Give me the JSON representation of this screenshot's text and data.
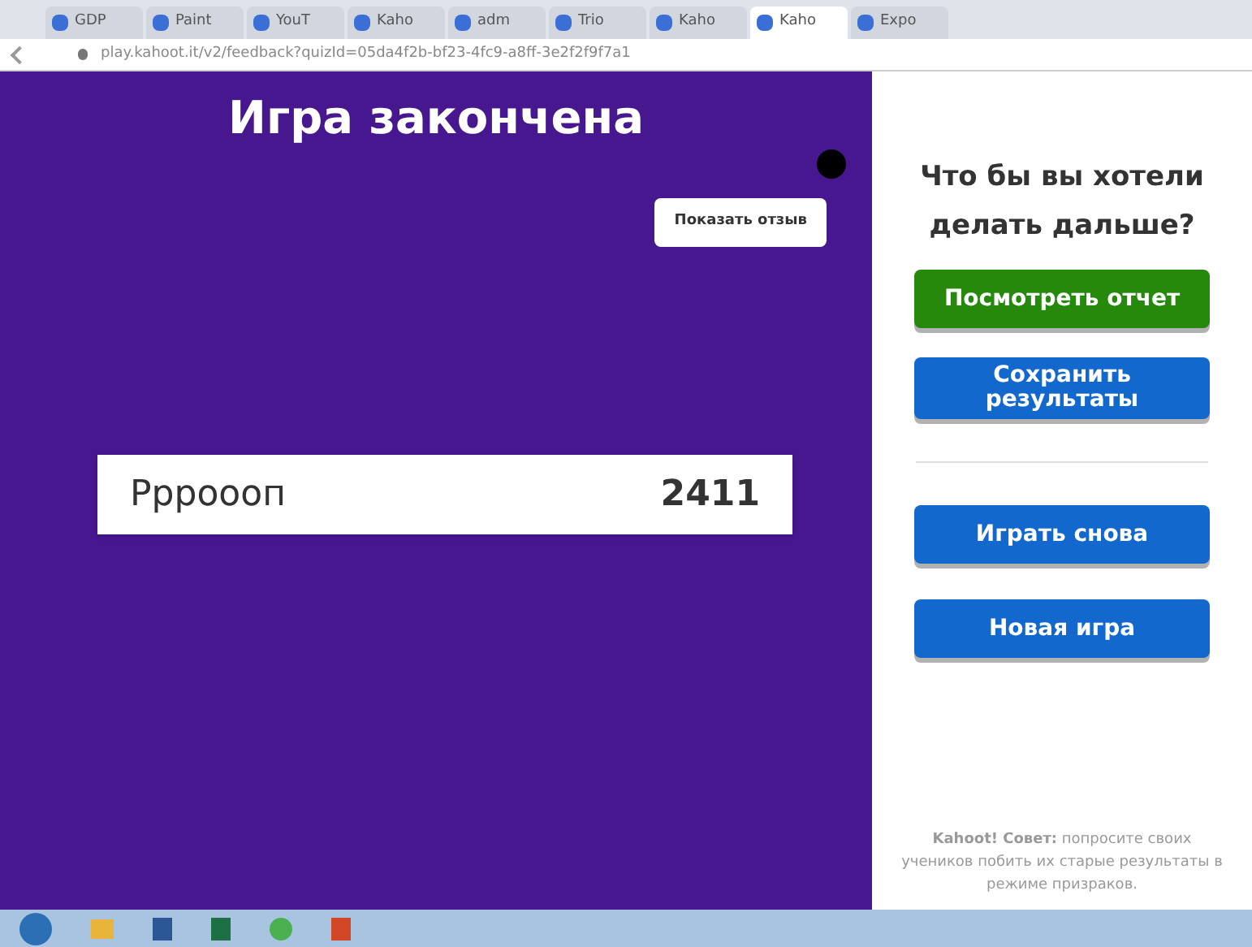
{
  "browser": {
    "tabs": [
      {
        "title": "GDP",
        "selected": false
      },
      {
        "title": "Paint",
        "selected": false
      },
      {
        "title": "YouT",
        "selected": false
      },
      {
        "title": "Kaho",
        "selected": false
      },
      {
        "title": "adm",
        "selected": false
      },
      {
        "title": "Trio",
        "selected": false
      },
      {
        "title": "Kaho",
        "selected": false
      },
      {
        "title": "Kaho",
        "selected": true
      },
      {
        "title": "Expo",
        "selected": false
      }
    ],
    "url": "play.kahoot.it/v2/feedback?quizId=05da4f2b-bf23-4fc9-a8ff-3e2f2f9f7a1"
  },
  "game": {
    "title": "Игра закончена",
    "feedback_button": "Показать отзыв",
    "player": {
      "name": "Ррроооп",
      "score": "2411"
    }
  },
  "panel": {
    "question": "Что бы вы хотели делать дальше?",
    "buttons": [
      {
        "label": "Посмотреть отчет",
        "kind": "green"
      },
      {
        "label": "Сохранить результаты",
        "kind": "blue"
      },
      {
        "label": "Играть снова",
        "kind": "blue"
      },
      {
        "label": "Новая игра",
        "kind": "blue"
      }
    ],
    "tip": "**Kahoot! Совет:** попросите своих учеников побить их старые результаты в режиме призраков."
  }
}
